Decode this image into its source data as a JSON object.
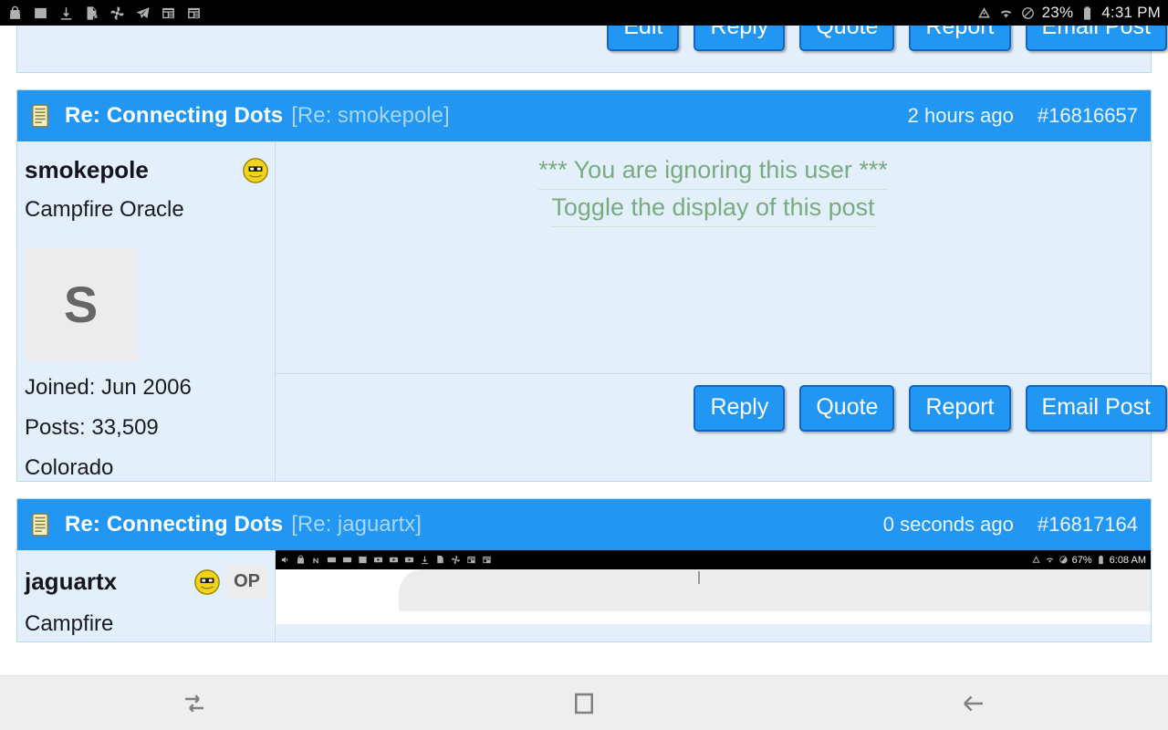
{
  "status_bar": {
    "icons": [
      "bag-icon",
      "image-icon",
      "download-icon",
      "file-error-icon",
      "pinwheel-icon",
      "telegram-icon",
      "news-icon",
      "news-alt-icon"
    ],
    "data_saver": "data-saver-icon",
    "wifi": "wifi-icon",
    "dnd": "do-not-disturb-icon",
    "battery_percent": "23%",
    "battery_icon": "battery-icon",
    "time": "4:31 PM"
  },
  "posts": [
    {
      "id": "post-partial-top",
      "buttons": [
        "Edit",
        "Reply",
        "Quote",
        "Report",
        "Email Post"
      ]
    },
    {
      "id": "post-smokepole",
      "header": {
        "icon": "notepad-icon",
        "title": "Re: Connecting Dots",
        "parent": "[Re: smokepole]",
        "time": "2 hours ago",
        "post_id": "#16816657"
      },
      "user": {
        "name": "smokepole",
        "smiley": "smiley-icon",
        "rank": "Campfire Oracle",
        "avatar_letter": "S",
        "joined": "Joined: Jun 2006",
        "posts": "Posts: 33,509",
        "location": "Colorado"
      },
      "content": {
        "ignore_notice": "*** You are ignoring this user ***",
        "toggle_link": "Toggle the display of this post"
      },
      "buttons": [
        "Reply",
        "Quote",
        "Report",
        "Email Post"
      ]
    },
    {
      "id": "post-jaguartx",
      "header": {
        "icon": "notepad-icon",
        "title": "Re: Connecting Dots",
        "parent": "[Re: jaguartx]",
        "time": "0 seconds ago",
        "post_id": "#16817164"
      },
      "user": {
        "name": "jaguartx",
        "smiley": "smiley-icon",
        "op_badge": "OP",
        "rank": "Campfire"
      },
      "embedded_screenshot": {
        "status_bar": {
          "icons": [
            "volume-icon",
            "bag-icon",
            "n-icon",
            "ebay-icon",
            "ebay-alt-icon",
            "image-icon",
            "video-icon",
            "video-alt-icon",
            "video-third-icon",
            "download-icon",
            "file-error-icon",
            "pinwheel-icon",
            "news-icon",
            "news-alt-icon"
          ],
          "data_saver": "data-saver-icon",
          "wifi": "wifi-icon",
          "dnd": "do-not-disturb-icon",
          "battery_percent": "67%",
          "battery_icon": "battery-icon",
          "time": "6:08 AM"
        }
      }
    }
  ],
  "nav_bar": {
    "recents": "recents-icon",
    "home": "home-square-icon",
    "back": "back-arrow-icon"
  },
  "colors": {
    "accent": "#2196f3",
    "post_bg": "#e3f0fb",
    "header_text": "#ffffff",
    "ignore_text": "#7aab7f",
    "button_border": "#1565c0"
  }
}
